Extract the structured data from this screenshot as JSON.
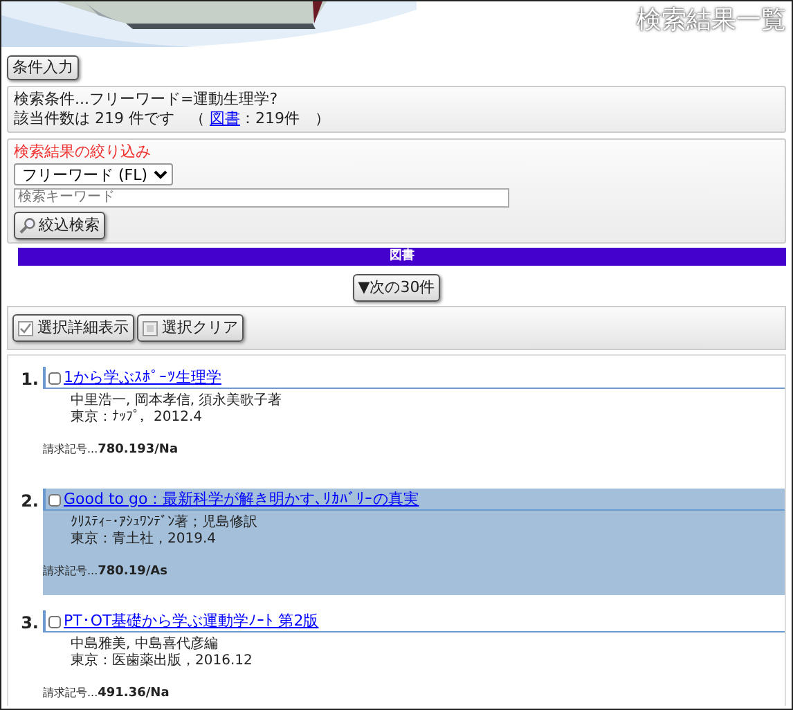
{
  "header": {
    "title": "検索結果一覧"
  },
  "condition_button": "条件入力",
  "search_info": {
    "condition": "検索条件...フリーワード=運動生理学?",
    "count_text": "該当件数は 219 件です　（",
    "category_link": "図書",
    "category_count": "：219件　）"
  },
  "refine": {
    "heading": "検索結果の絞り込み",
    "field_select": "フリーワード (FL)",
    "keyword": {
      "placeholder": "検索キーワード"
    },
    "button": "絞込検索"
  },
  "category_bar": "図書",
  "next_button": "▼次の30件",
  "toolbar": [
    "選択詳細表示",
    "選択クリア"
  ],
  "results": [
    {
      "number": "1.",
      "checked": false,
      "selected": false,
      "title": "1から学ぶｽﾎﾟｰﾂ生理学",
      "authors": "中里浩一, 岡本孝信, 須永美歌子著",
      "publication": "東京：ﾅｯﾌﾟ，2012.4",
      "call_number": "請求記号...**780.193/Na**"
    },
    {
      "number": "2.",
      "checked": false,
      "selected": true,
      "title": "Good to go：最新科学が解き明かす､ﾘｶﾊﾞﾘｰの真実",
      "authors": "ｸﾘｽﾃｨｰ･ｱｼｭﾜﾝﾃﾞﾝ著；児島修訳",
      "publication": "東京：青土社，2019.4",
      "call_number": "請求記号...**780.19/As**"
    },
    {
      "number": "3.",
      "checked": false,
      "selected": false,
      "title": "PT･OT基礎から学ぶ運動学ﾉｰﾄ 第2版",
      "authors": "中島雅美, 中島喜代彦編",
      "publication": "東京：医歯薬出版，2016.12",
      "call_number": "請求記号...**491.36/Na**"
    }
  ]
}
